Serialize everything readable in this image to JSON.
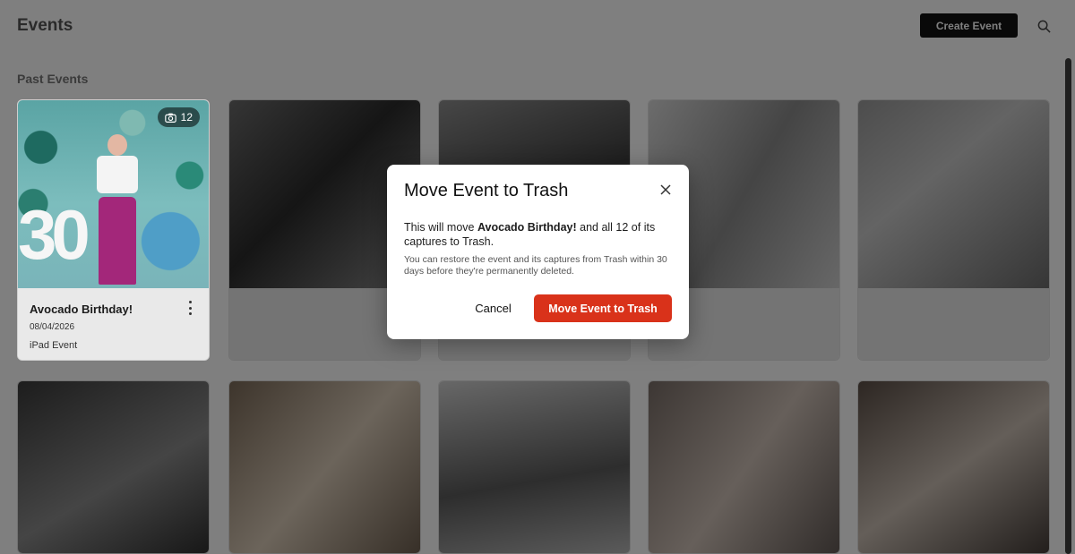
{
  "header": {
    "title": "Events",
    "create_label": "Create Event",
    "search_icon": "search-icon"
  },
  "section_title": "Past Events",
  "highlighted_card": {
    "name": "Avocado Birthday!",
    "date": "08/04/2026",
    "type": "iPad Event",
    "count": "12",
    "thumb_text": "30",
    "icons": {
      "camera": "camera-icon",
      "menu": "more-vertical-icon"
    }
  },
  "modal": {
    "title": "Move Event to Trash",
    "body_prefix": "This will move ",
    "event_name": "Avocado Birthday!",
    "body_suffix": " and all 12 of its captures to Trash.",
    "note": "You can restore the event and its captures from Trash within 30 days before they're permanently deleted.",
    "cancel_label": "Cancel",
    "confirm_label": "Move Event to Trash",
    "close_icon": "close-icon"
  },
  "colors": {
    "danger": "#d9321a",
    "create_button": "#121212"
  }
}
